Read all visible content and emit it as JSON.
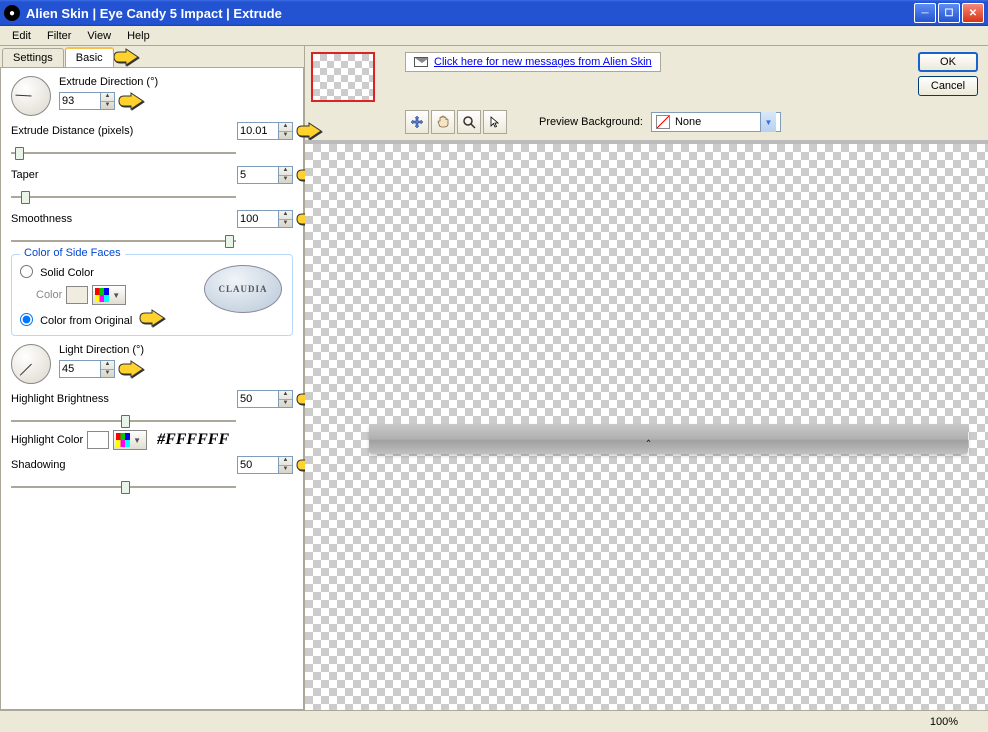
{
  "window": {
    "title": "Alien Skin  |  Eye Candy 5 Impact  |  Extrude"
  },
  "menu": {
    "items": [
      "Edit",
      "Filter",
      "View",
      "Help"
    ]
  },
  "tabs": {
    "settings": "Settings",
    "basic": "Basic"
  },
  "controls": {
    "extrude_direction": {
      "label": "Extrude Direction (°)",
      "value": "93"
    },
    "extrude_distance": {
      "label": "Extrude Distance (pixels)",
      "value": "10.01"
    },
    "taper": {
      "label": "Taper",
      "value": "5"
    },
    "smoothness": {
      "label": "Smoothness",
      "value": "100"
    },
    "side_faces": {
      "legend": "Color of Side Faces",
      "solid_label": "Solid Color",
      "color_label": "Color",
      "original_label": "Color from Original",
      "selected": "original"
    },
    "light_direction": {
      "label": "Light Direction (°)",
      "value": "45"
    },
    "highlight_brightness": {
      "label": "Highlight Brightness",
      "value": "50"
    },
    "highlight_color": {
      "label": "Highlight Color",
      "hex_display": "#FFFFFF"
    },
    "shadowing": {
      "label": "Shadowing",
      "value": "50"
    }
  },
  "claudia_text": "CLAUDIA",
  "message_link": "Click here for new messages from Alien Skin",
  "buttons": {
    "ok": "OK",
    "cancel": "Cancel"
  },
  "preview_bg": {
    "label": "Preview Background:",
    "value": "None"
  },
  "status": {
    "zoom": "100%"
  },
  "colors": {
    "titlebar": "#2353d0",
    "accent": "#f8c14e",
    "link": "#0000ee"
  }
}
